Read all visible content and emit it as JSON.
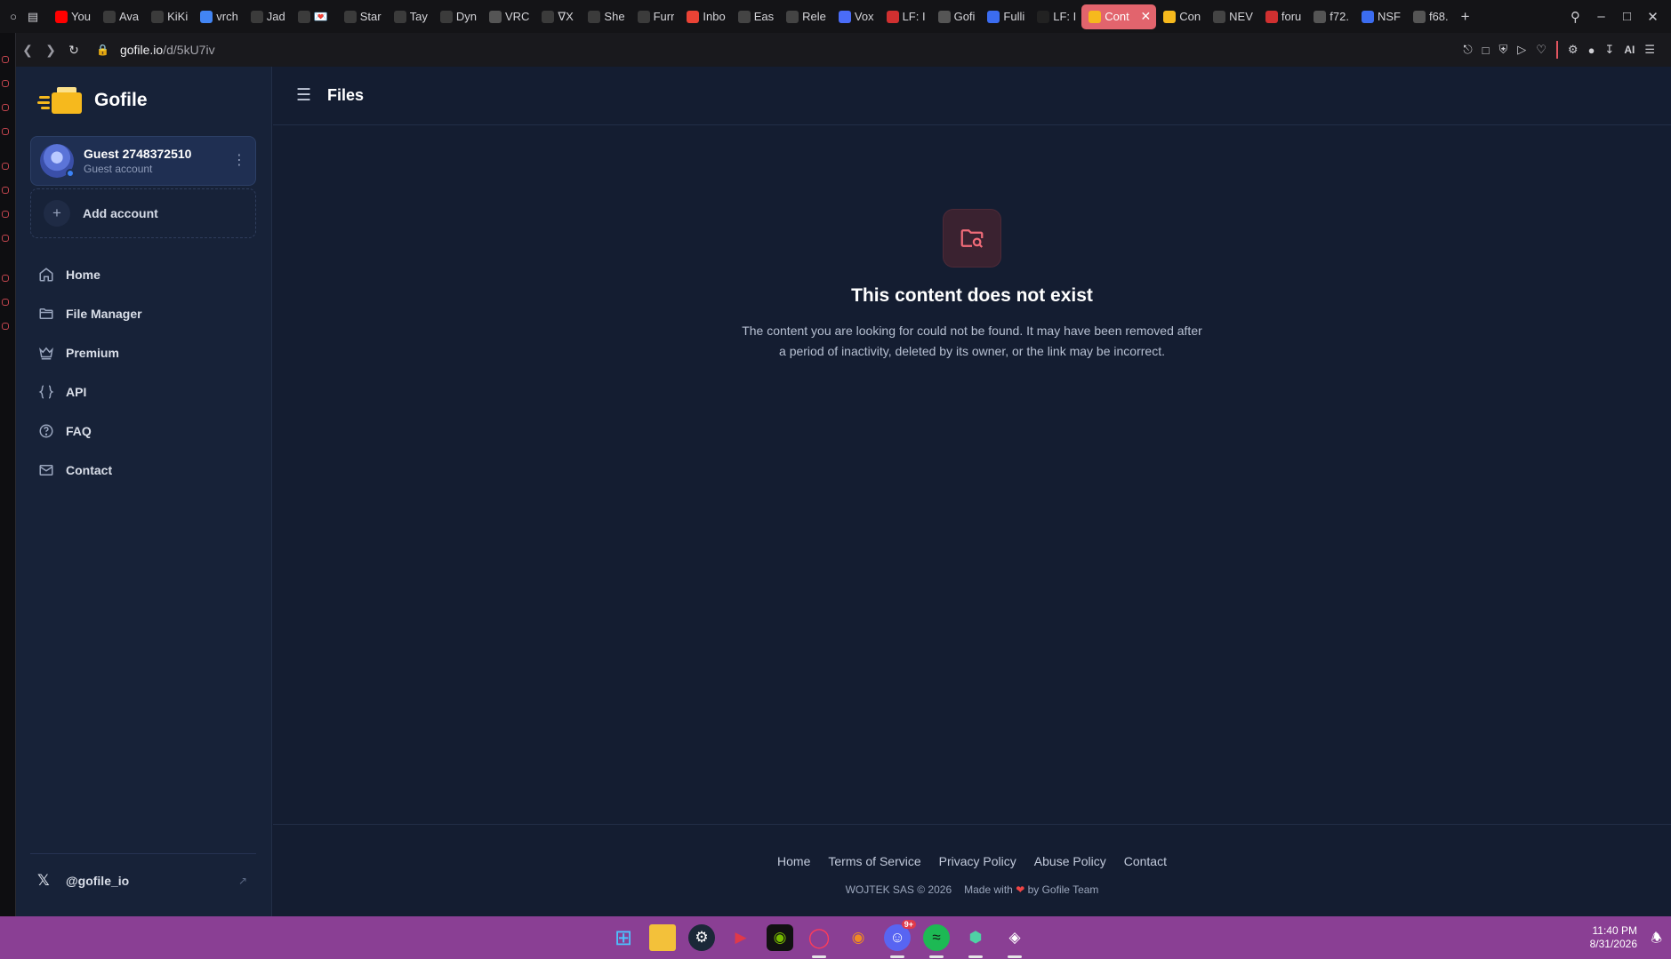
{
  "browser": {
    "tabs": [
      {
        "title": "You",
        "favicon": "youtube-icon",
        "color": "#ff0000"
      },
      {
        "title": "Ava",
        "favicon": "vrchat-icon",
        "color": "#3b3b3b"
      },
      {
        "title": "KiKi",
        "favicon": "vrchat-icon",
        "color": "#3b3b3b"
      },
      {
        "title": "vrch",
        "favicon": "google-icon",
        "color": "#4285f4"
      },
      {
        "title": "Jad",
        "favicon": "vrchat-icon",
        "color": "#3b3b3b"
      },
      {
        "title": "💌",
        "favicon": "vrchat-icon",
        "color": "#3b3b3b"
      },
      {
        "title": "Star",
        "favicon": "vrchat-icon",
        "color": "#3b3b3b"
      },
      {
        "title": "Tay",
        "favicon": "vrchat-icon",
        "color": "#3b3b3b"
      },
      {
        "title": "Dyn",
        "favicon": "vrchat-icon",
        "color": "#3b3b3b"
      },
      {
        "title": "VRC",
        "favicon": "vrcx-icon",
        "color": "#555"
      },
      {
        "title": "∇X",
        "favicon": "vrchat-icon",
        "color": "#3b3b3b"
      },
      {
        "title": "She",
        "favicon": "vrchat-icon",
        "color": "#3b3b3b"
      },
      {
        "title": "Furr",
        "favicon": "vrchat-icon",
        "color": "#3b3b3b"
      },
      {
        "title": "Inbo",
        "favicon": "gmail-icon",
        "color": "#ea4335"
      },
      {
        "title": "Eas",
        "favicon": "easy-icon",
        "color": "#444"
      },
      {
        "title": "Rele",
        "favicon": "github-icon",
        "color": "#444"
      },
      {
        "title": "Vox",
        "favicon": "vox-icon",
        "color": "#4a6cf7"
      },
      {
        "title": "LF: I",
        "favicon": "lf-icon",
        "color": "#d03030"
      },
      {
        "title": "Gofi",
        "favicon": "loading-icon",
        "color": "#555"
      },
      {
        "title": "Fulli",
        "favicon": "feather-icon",
        "color": "#3b6cf0"
      },
      {
        "title": "LF: I",
        "favicon": "lf-icon",
        "color": "#222"
      }
    ],
    "active_tab": {
      "title": "Cont",
      "favicon": "gofile-icon",
      "color": "#f6b91d"
    },
    "tabs_after": [
      {
        "title": "Con",
        "favicon": "gofile-icon",
        "color": "#f6b91d"
      },
      {
        "title": "NEV",
        "favicon": "nev-icon",
        "color": "#444"
      },
      {
        "title": "foru",
        "favicon": "forum-icon",
        "color": "#d03030"
      },
      {
        "title": "f72.",
        "favicon": "file-icon",
        "color": "#555"
      },
      {
        "title": "NSF",
        "favicon": "feather-icon",
        "color": "#3b6cf0"
      },
      {
        "title": "f68.",
        "favicon": "file-icon",
        "color": "#555"
      }
    ],
    "url_host": "gofile.io",
    "url_path": "/d/5kU7iv",
    "ai_label": "AI"
  },
  "sidebar": {
    "brand": "Gofile",
    "account": {
      "name": "Guest 2748372510",
      "type": "Guest account"
    },
    "add_account": "Add account",
    "nav": [
      {
        "label": "Home",
        "icon": "home-icon"
      },
      {
        "label": "File Manager",
        "icon": "folder-icon"
      },
      {
        "label": "Premium",
        "icon": "crown-icon"
      },
      {
        "label": "API",
        "icon": "braces-icon"
      },
      {
        "label": "FAQ",
        "icon": "help-circle-icon"
      },
      {
        "label": "Contact",
        "icon": "mail-icon"
      }
    ],
    "social_handle": "@gofile_io"
  },
  "main": {
    "title": "Files",
    "empty_state": {
      "title": "This content does not exist",
      "description": "The content you are looking for could not be found. It may have been removed after a period of inactivity, deleted by its owner, or the link may be incorrect."
    },
    "footer": {
      "links": [
        "Home",
        "Terms of Service",
        "Privacy Policy",
        "Abuse Policy",
        "Contact"
      ],
      "copyright": "WOJTEK SAS © 2026",
      "made_with_prefix": "Made with",
      "made_with_suffix": "by Gofile Team"
    }
  },
  "taskbar": {
    "apps": [
      "windows-start-icon",
      "file-explorer-icon",
      "steam-icon",
      "app-icon",
      "nvidia-icon",
      "opera-gx-icon",
      "blender-icon",
      "discord-icon",
      "spotify-icon",
      "app-cube-icon",
      "unity-icon"
    ],
    "discord_badge": "9+",
    "time": "11:40 PM",
    "date": "8/31/2026"
  },
  "colors": {
    "accent": "#e2646d",
    "page_bg": "#141d31",
    "sidebar_bg": "#172238",
    "taskbar": "#8a3f94",
    "brand": "#f6b91d"
  }
}
